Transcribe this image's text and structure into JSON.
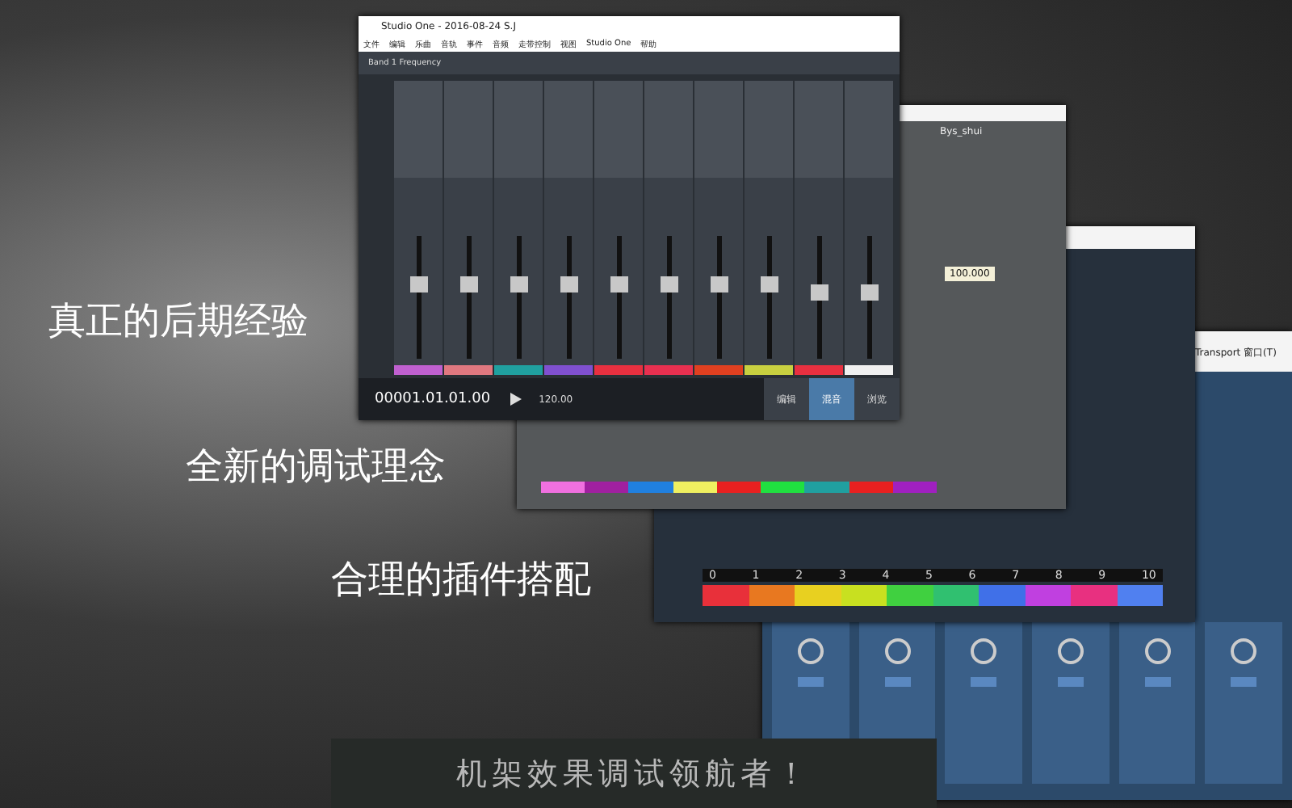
{
  "slogans": [
    {
      "text": "真正的后期经验"
    },
    {
      "text": "全新的调试理念"
    },
    {
      "text": "合理的插件搭配"
    }
  ],
  "banner": {
    "text": "机架效果调试领航者！"
  },
  "transport_window": {
    "title": "Transport 窗口(T)",
    "channels": [
      {
        "color": "#5a88c0"
      },
      {
        "color": "#5a88c0"
      },
      {
        "color": "#5a88c0"
      },
      {
        "color": "#5a88c0"
      },
      {
        "color": "#5a88c0"
      },
      {
        "color": "#5a88c0"
      }
    ]
  },
  "mixer_window": {
    "channel_numbers": [
      "0",
      "1",
      "2",
      "3",
      "4",
      "5",
      "6",
      "7",
      "8",
      "9",
      "10"
    ],
    "channels": [
      {
        "color": "#e8303a"
      },
      {
        "color": "#e87820"
      },
      {
        "color": "#e8d020"
      },
      {
        "color": "#c8e020"
      },
      {
        "color": "#40d040"
      },
      {
        "color": "#30c070"
      },
      {
        "color": "#4070e8"
      },
      {
        "color": "#c040e0"
      },
      {
        "color": "#e83080"
      },
      {
        "color": "#5080f0"
      }
    ]
  },
  "bus_window": {
    "title": "Bys_shui",
    "tooltip": "100.000",
    "channels": [
      {
        "color": "#f070e0"
      },
      {
        "color": "#a020a0"
      },
      {
        "color": "#2080e0"
      },
      {
        "color": "#f0f060"
      },
      {
        "color": "#e82020"
      },
      {
        "color": "#20e040"
      },
      {
        "color": "#20a0a0"
      },
      {
        "color": "#e82020"
      },
      {
        "color": "#a020c0"
      }
    ]
  },
  "studio_window": {
    "title": "Studio One - 2016-08-24 S.J",
    "menu": [
      "文件",
      "编辑",
      "乐曲",
      "音轨",
      "事件",
      "音频",
      "走带控制",
      "视图",
      "Studio One",
      "帮助"
    ],
    "track_name": "Band 1 Frequency",
    "channels": [
      {
        "color": "#c060d0",
        "level": 0.62
      },
      {
        "color": "#e07880",
        "level": 0.62
      },
      {
        "color": "#20a0a0",
        "level": 0.62
      },
      {
        "color": "#8050d0",
        "level": 0.62
      },
      {
        "color": "#e83040",
        "level": 0.62
      },
      {
        "color": "#e83050",
        "level": 0.62
      },
      {
        "color": "#e04020",
        "level": 0.62
      },
      {
        "color": "#c8d040",
        "level": 0.62
      },
      {
        "color": "#e83040",
        "level": 0.55
      },
      {
        "color": "#f0f0f0",
        "level": 0.55
      }
    ],
    "time": "00001.01.01.00",
    "tempo": "120.00",
    "view_tabs": [
      {
        "label": "编辑",
        "selected": false
      },
      {
        "label": "混音",
        "selected": true
      },
      {
        "label": "浏览",
        "selected": false
      }
    ]
  }
}
